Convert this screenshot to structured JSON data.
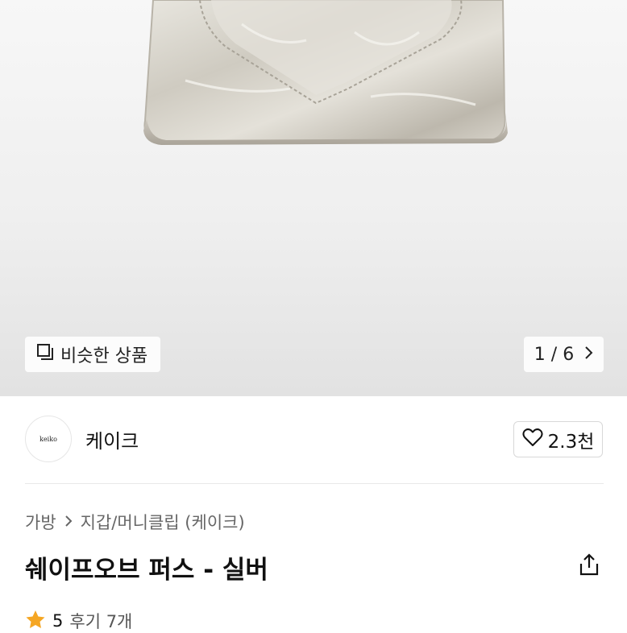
{
  "gallery": {
    "similar_label": "비슷한 상품",
    "page_indicator": "1 / 6"
  },
  "store": {
    "name": "케이크",
    "logo_text": "keiko",
    "like_count": "2.3천"
  },
  "breadcrumb": {
    "category": "가방",
    "subcategory": "지갑/머니클립 (케이크)"
  },
  "product": {
    "title": "쉐이프오브 퍼스 - 실버",
    "rating": "5",
    "reviews": "후기 7개"
  },
  "colors": {
    "star": "#f5a623",
    "text": "#111111",
    "muted": "#666666"
  },
  "icons": {
    "similar": "copy-squares-icon",
    "pager": "chevron-right-icon",
    "like": "heart-outline-icon",
    "share": "share-icon",
    "star": "star-icon"
  }
}
